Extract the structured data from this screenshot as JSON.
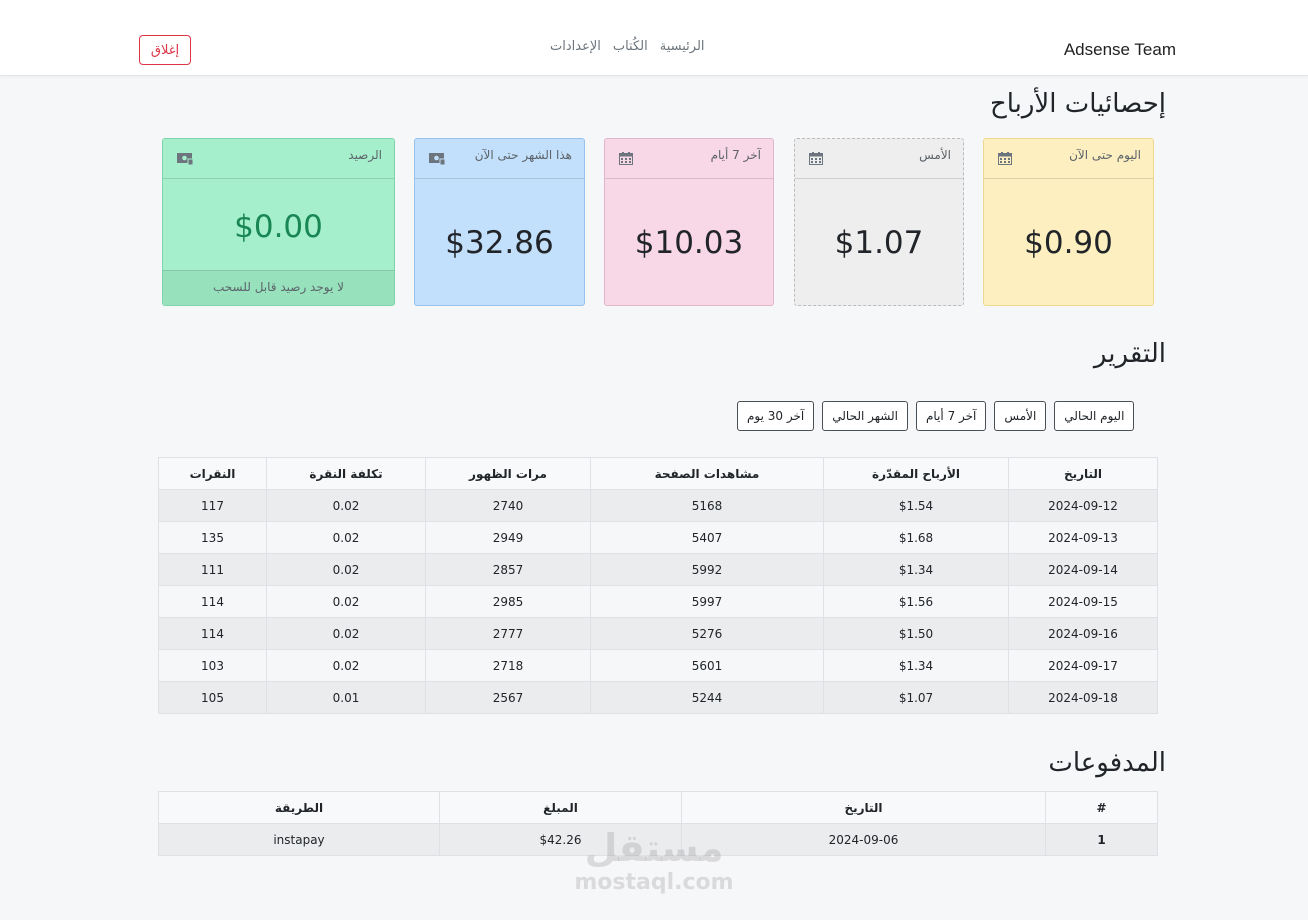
{
  "navbar": {
    "brand": "Adsense Team",
    "links": [
      "الرئيسية",
      "الكُتاب",
      "الإعدادات"
    ],
    "close_label": "إغلاق"
  },
  "earnings": {
    "title": "إحصائيات الأرباح",
    "cards": [
      {
        "label": "اليوم حتى الآن",
        "value": "$0.90",
        "icon": "calendar-icon"
      },
      {
        "label": "الأمس",
        "value": "$1.07",
        "icon": "calendar-icon"
      },
      {
        "label": "آخر 7 أيام",
        "value": "$10.03",
        "icon": "calendar-icon"
      },
      {
        "label": "هذا الشهر حتى الآن",
        "value": "$32.86",
        "icon": "money-icon"
      },
      {
        "label": "الرصيد",
        "value": "$0.00",
        "icon": "money-icon",
        "footer": "لا يوجد رصيد قابل للسحب"
      }
    ]
  },
  "report": {
    "title": "التقرير",
    "filters": [
      "اليوم الحالي",
      "الأمس",
      "آخر 7 أيام",
      "الشهر الحالي",
      "آخر 30 يوم"
    ],
    "headers": [
      "التاريخ",
      "الأرباح المقدّرة",
      "مشاهدات الصفحة",
      "مرات الظهور",
      "تكلفة النقرة",
      "النقرات"
    ],
    "rows": [
      [
        "2024-09-12",
        "$1.54",
        "5168",
        "2740",
        "0.02",
        "117"
      ],
      [
        "2024-09-13",
        "$1.68",
        "5407",
        "2949",
        "0.02",
        "135"
      ],
      [
        "2024-09-14",
        "$1.34",
        "5992",
        "2857",
        "0.02",
        "111"
      ],
      [
        "2024-09-15",
        "$1.56",
        "5997",
        "2985",
        "0.02",
        "114"
      ],
      [
        "2024-09-16",
        "$1.50",
        "5276",
        "2777",
        "0.02",
        "114"
      ],
      [
        "2024-09-17",
        "$1.34",
        "5601",
        "2718",
        "0.02",
        "103"
      ],
      [
        "2024-09-18",
        "$1.07",
        "5244",
        "2567",
        "0.01",
        "105"
      ]
    ]
  },
  "payments": {
    "title": "المدفوعات",
    "headers": [
      "#",
      "التاريخ",
      "المبلغ",
      "الطريقة"
    ],
    "rows": [
      [
        "1",
        "2024-09-06",
        "$42.26",
        "instapay"
      ]
    ]
  },
  "watermark": {
    "arabic": "مستقل",
    "latin": "mostaql.com"
  },
  "colors": {
    "card_today": "#fdefbf",
    "card_yesterday": "#eeeeee",
    "card_week": "#f8d7e6",
    "card_month": "#c2e0fb",
    "card_balance": "#a6efcd",
    "balance_text": "#198754",
    "danger": "#dc3545"
  }
}
